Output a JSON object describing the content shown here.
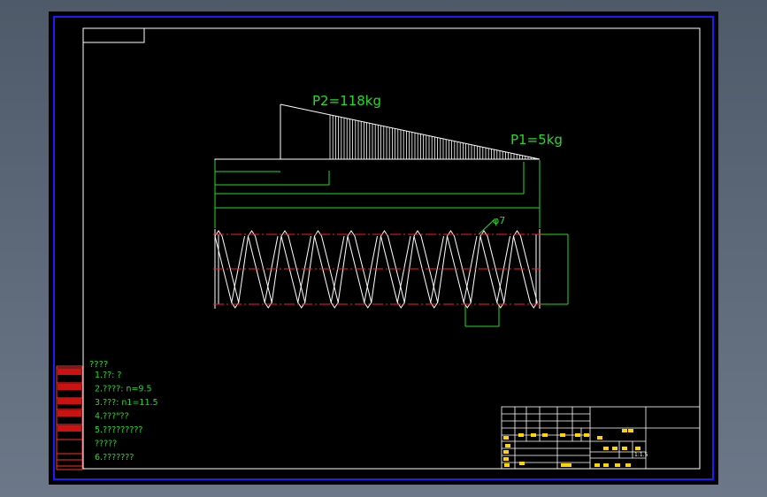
{
  "drawing": {
    "load_labels": {
      "p2": "P2=118kg",
      "p1": "P1=5kg"
    },
    "wire_diameter_label": "φ7",
    "dimensions": {
      "d1": "",
      "d2": "",
      "d3": "",
      "d4": "",
      "height": "",
      "pitch": ""
    }
  },
  "notes": {
    "title": "????",
    "lines": [
      "1.??:    ?",
      "2.????: n=9.5",
      "3.???:  n1=11.5",
      "4.???\"??",
      "5.?????????",
      "   ?????",
      "6.???????"
    ]
  },
  "left_margin_labels": [
    "",
    "",
    "",
    "",
    ""
  ],
  "title_block": {
    "drawing_name": "",
    "company": "",
    "scale": "1:1.5",
    "sheet": ""
  },
  "colors": {
    "background": "#000000",
    "outer_frame": "#1b1bff",
    "lines": "#ffffff",
    "dimension": "#22dd22",
    "centerline": "#ff2020",
    "label_fill": "#cc1111"
  }
}
